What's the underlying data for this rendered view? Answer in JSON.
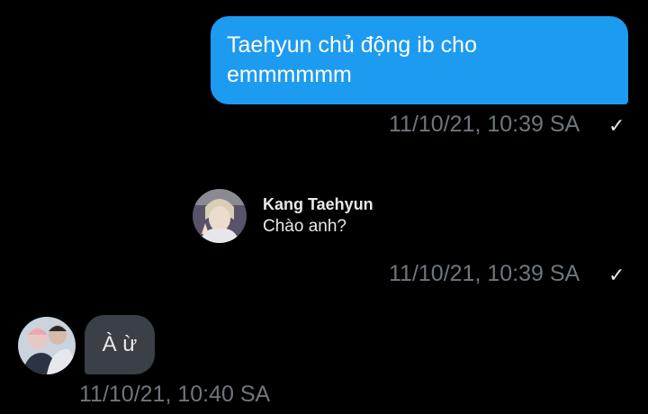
{
  "messages": {
    "sent": {
      "line1": "Taehyun chủ động ib cho",
      "line2": "emmmmmm",
      "timestamp": "11/10/21, 10:39 SA",
      "status_icon": "check-icon"
    },
    "shared": {
      "name": "Kang Taehyun",
      "text": "Chào anh?",
      "timestamp": "11/10/21, 10:39 SA",
      "status_icon": "check-icon"
    },
    "received": {
      "text": "À ừ",
      "timestamp": "11/10/21, 10:40 SA"
    }
  },
  "colors": {
    "background": "#000000",
    "sent_bubble": "#1d9bf0",
    "received_bubble": "#3a4046",
    "timestamp": "#6e767d"
  }
}
